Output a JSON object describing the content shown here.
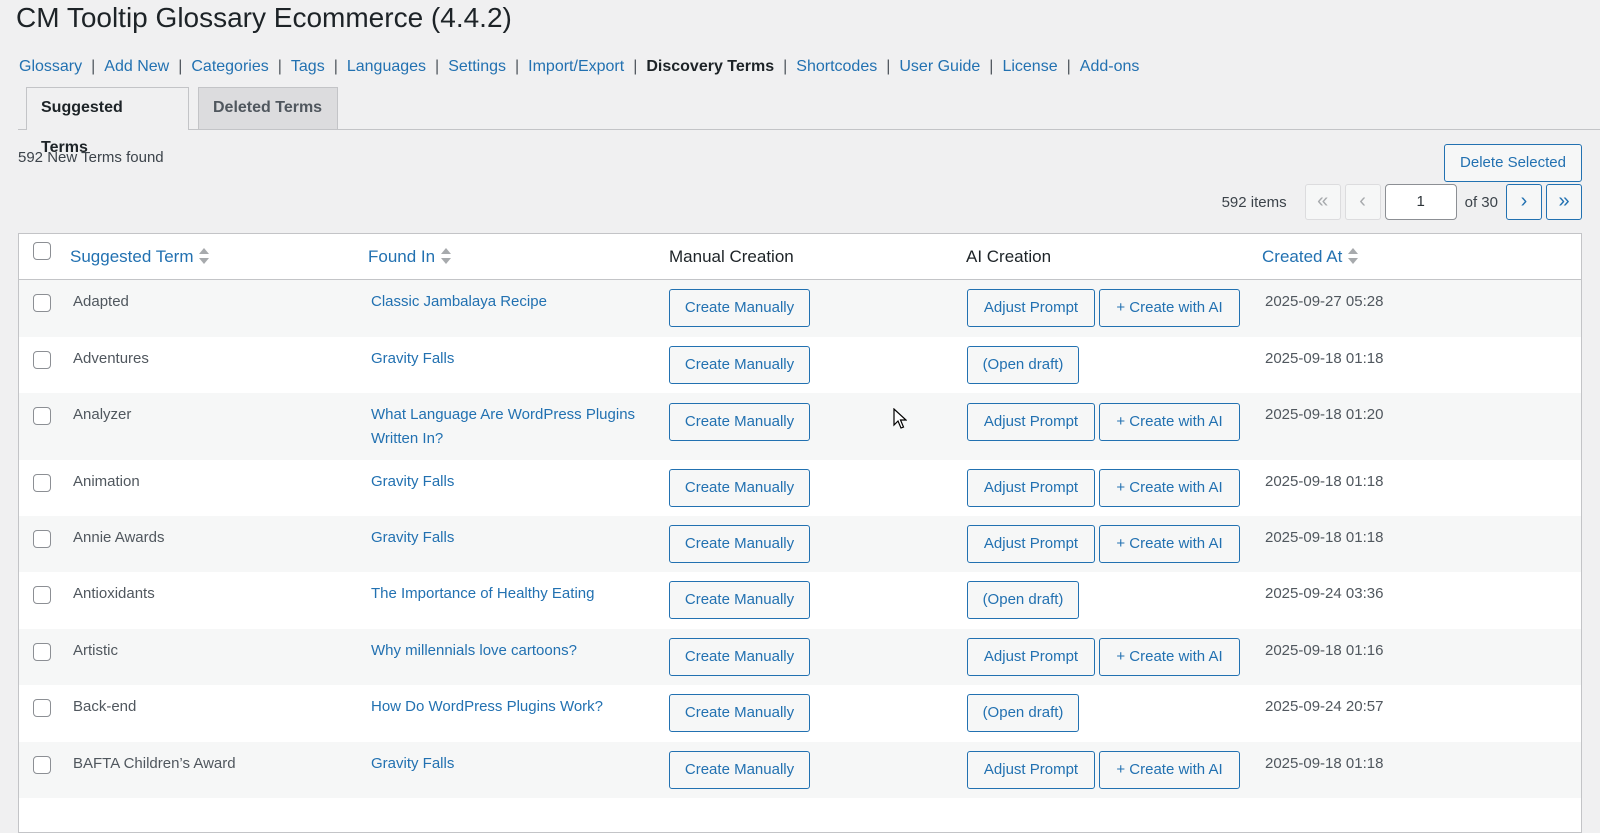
{
  "page": {
    "title": "CM Tooltip Glossary Ecommerce (4.4.2)"
  },
  "subnav": [
    {
      "label": "Glossary",
      "current": false
    },
    {
      "label": "Add New",
      "current": false
    },
    {
      "label": "Categories",
      "current": false
    },
    {
      "label": "Tags",
      "current": false
    },
    {
      "label": "Languages",
      "current": false
    },
    {
      "label": "Settings",
      "current": false
    },
    {
      "label": "Import/Export",
      "current": false
    },
    {
      "label": "Discovery Terms",
      "current": true
    },
    {
      "label": "Shortcodes",
      "current": false
    },
    {
      "label": "User Guide",
      "current": false
    },
    {
      "label": "License",
      "current": false
    },
    {
      "label": "Add-ons",
      "current": false
    }
  ],
  "subnav_separator": "|",
  "tabs": {
    "suggested": "Suggested Terms",
    "deleted": "Deleted Terms"
  },
  "summary": {
    "terms_found": "592 New Terms found"
  },
  "actions": {
    "delete_selected": "Delete Selected"
  },
  "pagination": {
    "items": "592 items",
    "first": "«",
    "prev": "‹",
    "current_page": "1",
    "of_total": "of 30",
    "next": "›",
    "last": "»"
  },
  "table": {
    "columns": {
      "term": "Suggested Term",
      "found_in": "Found In",
      "manual": "Manual Creation",
      "ai": "AI Creation",
      "created": "Created At"
    },
    "button_labels": {
      "create_manually": "Create Manually",
      "adjust_prompt": "Adjust Prompt",
      "create_with_ai": "+ Create with AI",
      "open_draft": "(Open draft)"
    },
    "rows": [
      {
        "term": "Adapted",
        "found_in": "Classic Jambalaya Recipe",
        "ai_state": "prompt",
        "created": "2025-09-27 05:28"
      },
      {
        "term": "Adventures",
        "found_in": "Gravity Falls",
        "ai_state": "draft",
        "created": "2025-09-18 01:18"
      },
      {
        "term": "Analyzer",
        "found_in": "What Language Are WordPress Plugins Written In?",
        "ai_state": "prompt",
        "created": "2025-09-18 01:20"
      },
      {
        "term": "Animation",
        "found_in": "Gravity Falls",
        "ai_state": "prompt",
        "created": "2025-09-18 01:18"
      },
      {
        "term": "Annie Awards",
        "found_in": "Gravity Falls",
        "ai_state": "prompt",
        "created": "2025-09-18 01:18"
      },
      {
        "term": "Antioxidants",
        "found_in": "The Importance of Healthy Eating",
        "ai_state": "draft",
        "created": "2025-09-24 03:36"
      },
      {
        "term": "Artistic",
        "found_in": "Why millennials love cartoons?",
        "ai_state": "prompt",
        "created": "2025-09-18 01:16"
      },
      {
        "term": "Back-end",
        "found_in": "How Do WordPress Plugins Work?",
        "ai_state": "draft",
        "created": "2025-09-24 20:57"
      },
      {
        "term": "BAFTA Children’s Award",
        "found_in": "Gravity Falls",
        "ai_state": "prompt",
        "created": "2025-09-18 01:18"
      }
    ]
  }
}
